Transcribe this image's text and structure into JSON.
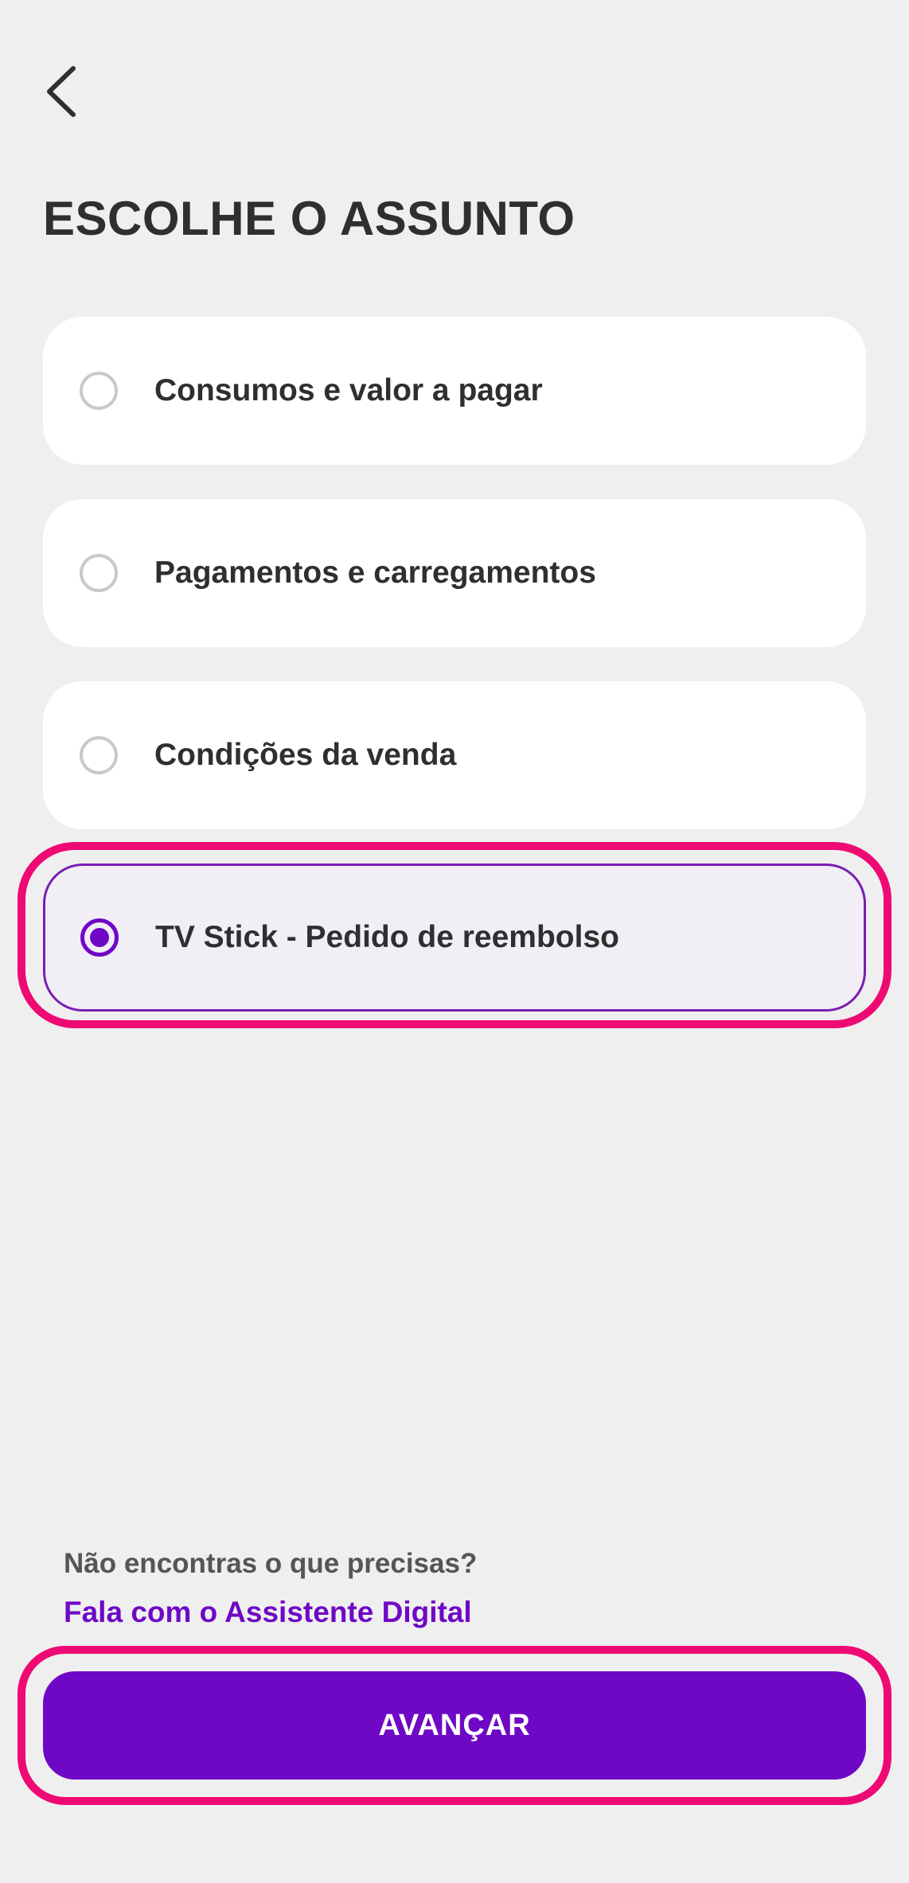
{
  "header": {
    "back_icon": "chevron-left-icon",
    "title": "ESCOLHE O ASSUNTO"
  },
  "options": [
    {
      "label": "Consumos e valor a pagar",
      "selected": false
    },
    {
      "label": "Pagamentos e carregamentos",
      "selected": false
    },
    {
      "label": "Condições da venda",
      "selected": false
    },
    {
      "label": "TV Stick - Pedido de reembolso",
      "selected": true
    }
  ],
  "help": {
    "question": "Não encontras o que precisas?",
    "link": "Fala com o Assistente Digital"
  },
  "footer": {
    "primary_button": "AVANÇAR"
  },
  "colors": {
    "accent": "#6f08c6",
    "highlight": "#ee0a73",
    "background": "#efefef"
  }
}
